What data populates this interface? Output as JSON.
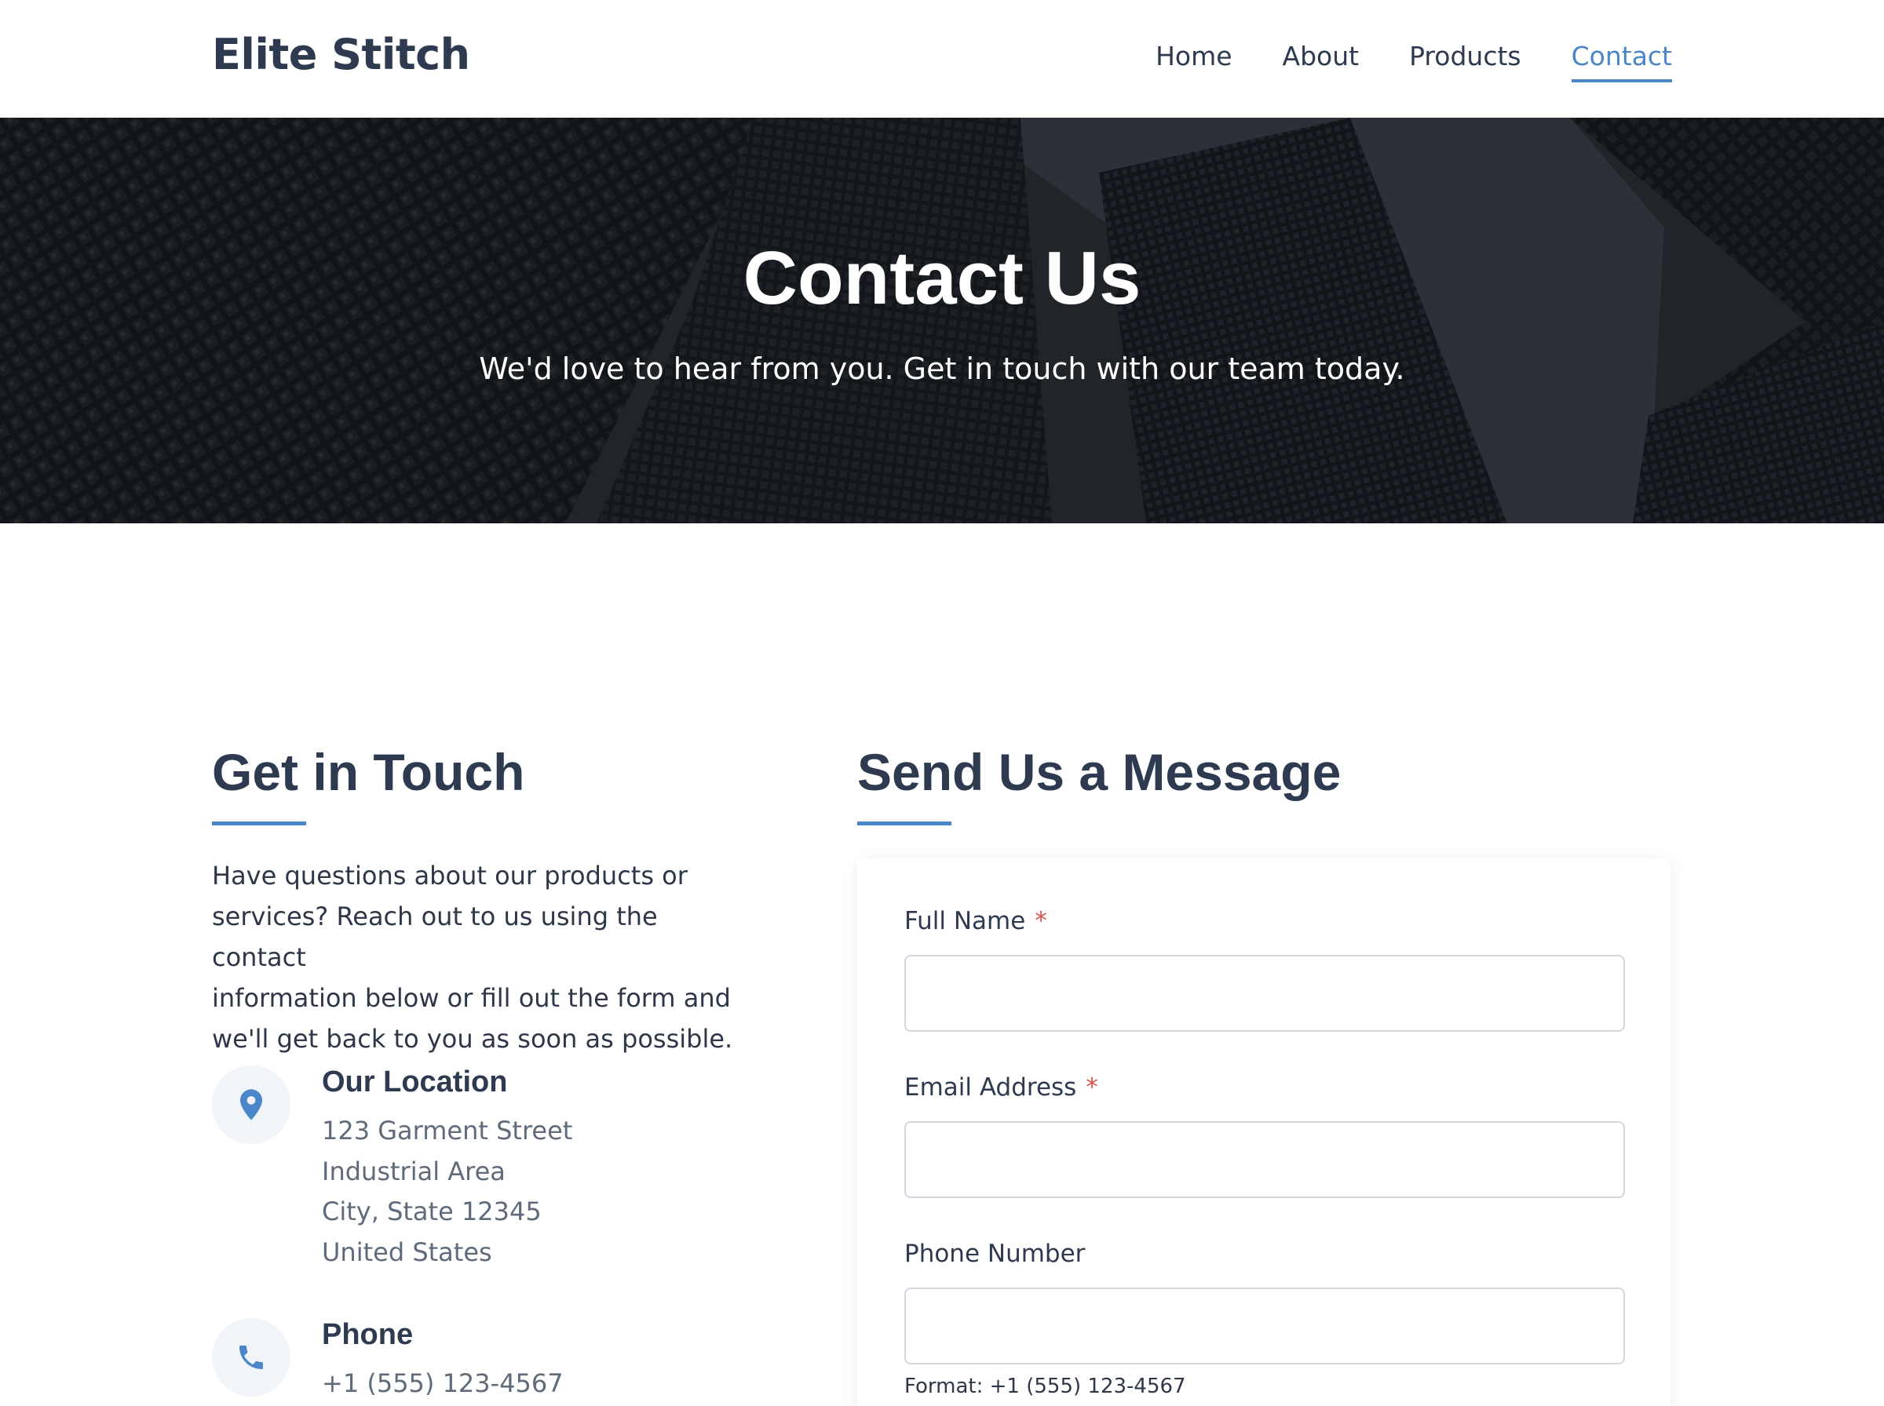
{
  "header": {
    "brand": "Elite Stitch",
    "nav": [
      {
        "label": "Home",
        "active": false
      },
      {
        "label": "About",
        "active": false
      },
      {
        "label": "Products",
        "active": false
      },
      {
        "label": "Contact",
        "active": true
      }
    ]
  },
  "hero": {
    "title": "Contact Us",
    "subtitle": "We'd love to hear from you. Get in touch with our team today."
  },
  "get_in_touch": {
    "title": "Get in Touch",
    "intro_lines": [
      "Have questions about our products or",
      "services? Reach out to us using the contact",
      "information below or fill out the form and",
      "we'll get back to you as soon as possible."
    ],
    "location": {
      "icon": "location-pin-icon",
      "heading": "Our Location",
      "lines": [
        "123 Garment Street",
        "Industrial Area",
        "City, State 12345",
        "United States"
      ]
    },
    "phone": {
      "icon": "phone-icon",
      "heading": "Phone",
      "lines": [
        "+1 (555) 123-4567"
      ]
    }
  },
  "message_form": {
    "title": "Send Us a Message",
    "fields": {
      "full_name": {
        "label": "Full Name",
        "required_mark": "*",
        "value": ""
      },
      "email": {
        "label": "Email Address",
        "required_mark": "*",
        "value": ""
      },
      "phone": {
        "label": "Phone Number",
        "value": "",
        "hint": "Format: +1 (555) 123-4567"
      }
    }
  },
  "colors": {
    "accent": "#4a86c8",
    "heading": "#2d3a4f",
    "required": "#d9534f",
    "muted_text": "#5f6b7a"
  }
}
